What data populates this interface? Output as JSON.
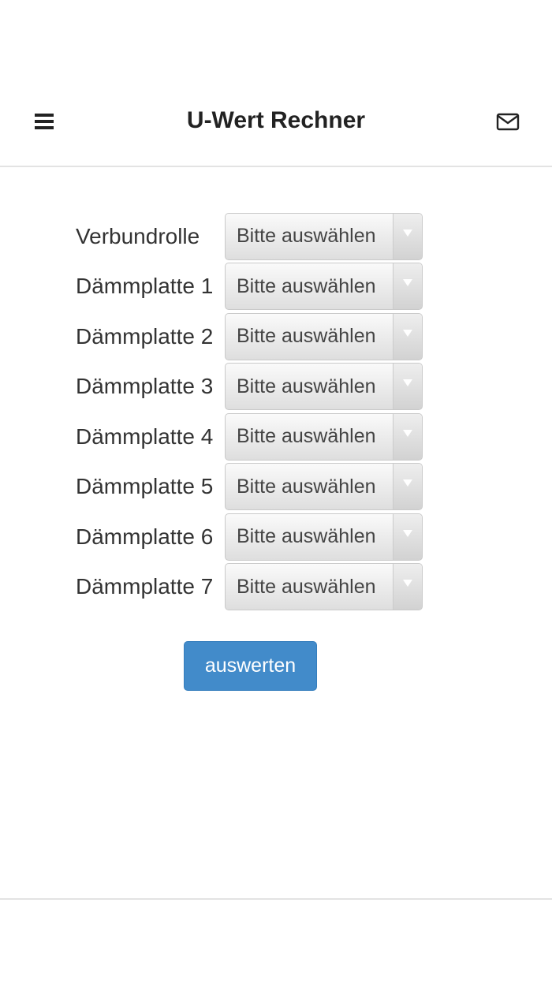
{
  "header": {
    "title": "U-Wert Rechner",
    "menu_icon": "hamburger-menu-icon",
    "mail_icon": "envelope-icon"
  },
  "form": {
    "rows": [
      {
        "label": "Verbundrolle",
        "value": "Bitte auswählen"
      },
      {
        "label": "Dämmplatte 1",
        "value": "Bitte auswählen"
      },
      {
        "label": "Dämmplatte 2",
        "value": "Bitte auswählen"
      },
      {
        "label": "Dämmplatte 3",
        "value": "Bitte auswählen"
      },
      {
        "label": "Dämmplatte 4",
        "value": "Bitte auswählen"
      },
      {
        "label": "Dämmplatte 5",
        "value": "Bitte auswählen"
      },
      {
        "label": "Dämmplatte 6",
        "value": "Bitte auswählen"
      },
      {
        "label": "Dämmplatte 7",
        "value": "Bitte auswählen"
      }
    ],
    "submit_label": "auswerten"
  },
  "colors": {
    "primary_button": "#428bca",
    "title_text": "#222222",
    "divider": "#e3e3e3"
  }
}
